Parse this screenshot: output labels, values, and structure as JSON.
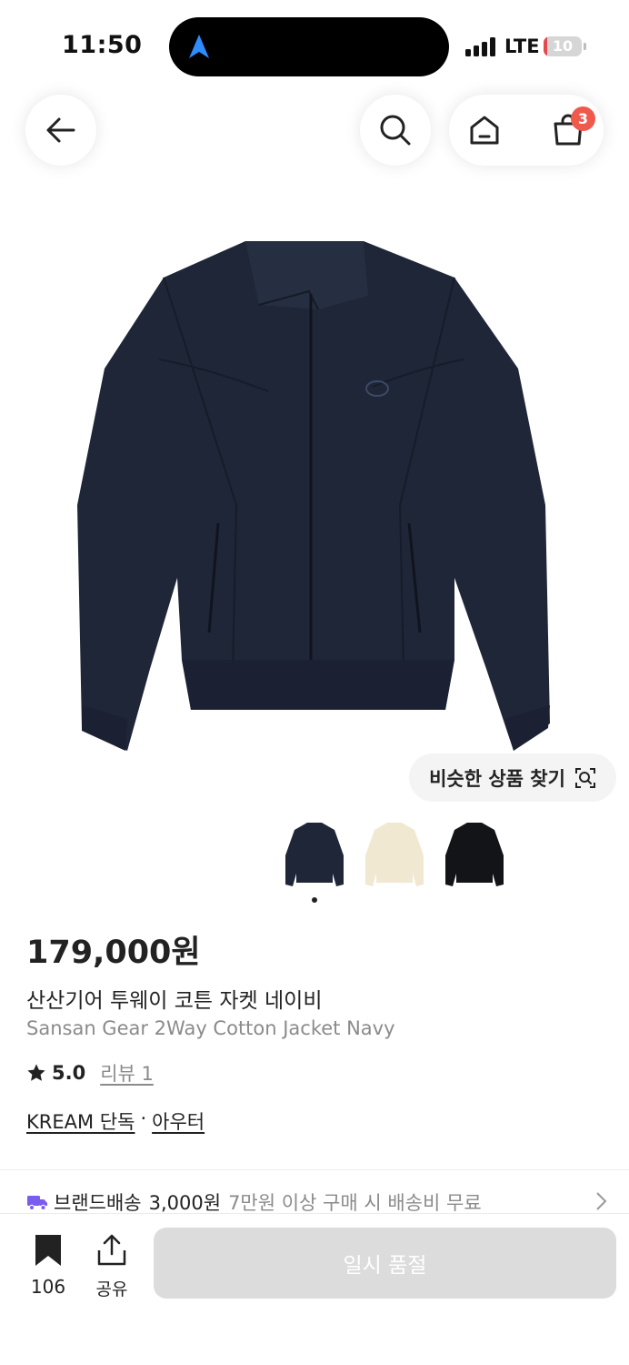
{
  "status_bar": {
    "time": "11:50",
    "network": "LTE",
    "battery_level": "10",
    "battery_fraction": 0.1,
    "battery_color": "#e5484d"
  },
  "nav": {
    "back_icon": "arrow-left-icon",
    "search_icon": "search-icon",
    "home_icon": "home-icon",
    "cart_icon": "shopping-bag-icon",
    "cart_count": "3"
  },
  "product": {
    "image_alt_icon": "navy-jacket-image",
    "similar_button_label": "비슷한 상품 찾기",
    "thumbnails": [
      {
        "name": "navy",
        "color": "#1f2637"
      },
      {
        "name": "ivory",
        "color": "#f1e8d2"
      },
      {
        "name": "black",
        "color": "#131417"
      }
    ],
    "selected_thumbnail": 0,
    "price": "179,000원",
    "name_ko": "산산기어 투웨이 코튼 자켓 네이비",
    "name_en": "Sansan Gear 2Way Cotton Jacket Navy",
    "rating": "5.0",
    "review_label": "리뷰 1",
    "tag_exclusive": "KREAM 단독",
    "tag_separator": "·",
    "tag_category": "아우터"
  },
  "shipping": {
    "brand_label": "브랜드배송",
    "fee": "3,000원",
    "note": "7만원 이상 구매 시 배송비 무료",
    "icon": "truck-icon",
    "accent": "#7a5cf0"
  },
  "bottom_bar": {
    "bookmark_count": "106",
    "share_label": "공유",
    "action_label": "일시 품절"
  }
}
